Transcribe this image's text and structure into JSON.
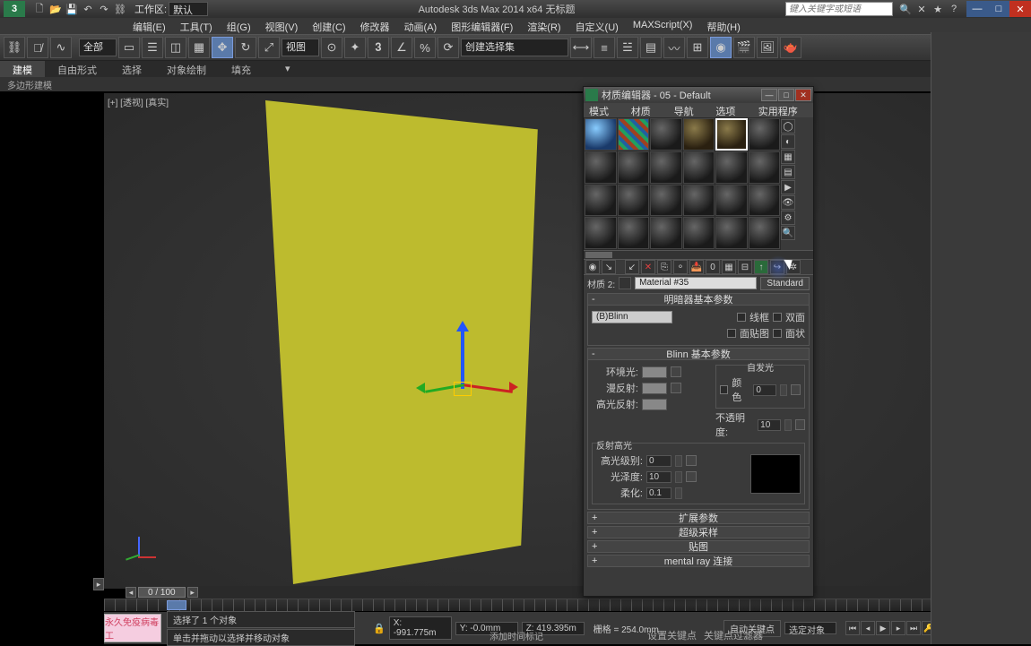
{
  "titlebar": {
    "workspace_label": "工作区:",
    "workspace_value": "默认",
    "app_title": "Autodesk 3ds Max 2014 x64   无标题",
    "search_placeholder": "键入关键字或短语"
  },
  "menu": {
    "items": [
      "编辑(E)",
      "工具(T)",
      "组(G)",
      "视图(V)",
      "创建(C)",
      "修改器",
      "动画(A)",
      "图形编辑器(F)",
      "渲染(R)",
      "自定义(U)",
      "MAXScript(X)",
      "帮助(H)"
    ]
  },
  "maintool": {
    "sel_filter": "全部",
    "view_combo": "视图",
    "named_sel": "创建选择集"
  },
  "ribbon": {
    "tabs": [
      "建模",
      "自由形式",
      "选择",
      "对象绘制",
      "填充"
    ],
    "sub": "多边形建模"
  },
  "viewport": {
    "label": "[+] [透视] [真实]"
  },
  "timeslider": {
    "frame": "0 / 100"
  },
  "status": {
    "pink": "永久免疫病毒工",
    "sel_msg": "选择了 1 个对象",
    "hint_msg": "单击并拖动以选择并移动对象",
    "x": "X: -991.775m",
    "y": "Y: -0.0mm",
    "z": "Z: 419.395m",
    "grid": "栅格 = 254.0mm",
    "addtime": "添加时间标记",
    "autokey": "自动关键点",
    "autokey_combo": "选定对象",
    "setkey": "设置关键点",
    "keyfilter": "关键点过滤器"
  },
  "mateditor": {
    "title": "材质编辑器 - 05 - Default",
    "menu": [
      "模式(D)",
      "材质(M)",
      "导航(N)",
      "选项(O)",
      "实用程序(U)"
    ],
    "slot_label": "材质 2:",
    "mat_name": "Material #35",
    "type_btn": "Standard",
    "roll_shader_hdr": "明暗器基本参数",
    "shader_combo": "(B)Blinn",
    "chk_wire": "线框",
    "chk_2side": "双面",
    "chk_facemap": "面贴图",
    "chk_faceted": "面状",
    "roll_blinn_hdr": "Blinn 基本参数",
    "grp_selfillum": "自发光",
    "lab_color": "颜色",
    "val_selfillum": "0",
    "lab_ambient": "环境光:",
    "lab_diffuse": "漫反射:",
    "lab_specular": "高光反射:",
    "lab_opacity": "不透明度:",
    "val_opacity": "10",
    "grp_highlights": "反射高光",
    "lab_speclevel": "高光级别:",
    "val_speclevel": "0",
    "lab_gloss": "光泽度:",
    "val_gloss": "10",
    "lab_soften": "柔化:",
    "val_soften": "0.1",
    "roll_ext": "扩展参数",
    "roll_ss": "超级采样",
    "roll_maps": "贴图",
    "roll_mr": "mental ray 连接"
  }
}
